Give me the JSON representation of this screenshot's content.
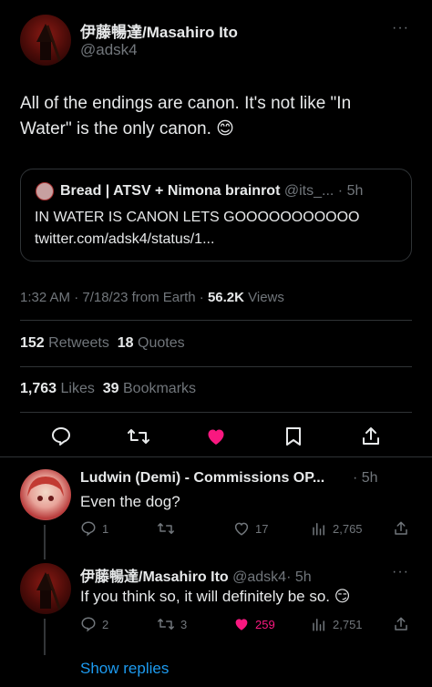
{
  "main_tweet": {
    "author_name": "伊藤暢達/Masahiro Ito",
    "handle": "@adsk4",
    "text": "All of the endings are canon. It's not like \"In Water\" is the only canon.",
    "emoji": "😊",
    "quote": {
      "author_name": "Bread | ATSV + Nimona brainrot",
      "handle": "@its_...",
      "time": "· 5h",
      "text": "IN WATER IS CANON LETS GOOOOOOOOOOO",
      "link": "twitter.com/adsk4/status/1..."
    },
    "meta_time": "1:32 AM · 7/18/23 from Earth · ",
    "views_count": "56.2K",
    "views_label": " Views",
    "stats": {
      "retweets_count": "152",
      "retweets_label": "Retweets",
      "quotes_count": "18",
      "quotes_label": "Quotes",
      "likes_count": "1,763",
      "likes_label": "Likes",
      "bookmarks_count": "39",
      "bookmarks_label": "Bookmarks"
    }
  },
  "replies": [
    {
      "author_name": "Ludwin (Demi) - Commissions OP...",
      "time": "· 5h",
      "text": "Even the dog?",
      "reply_count": "1",
      "retweet_count": "",
      "like_count": "17",
      "view_count": "2,765"
    },
    {
      "author_name": "伊藤暢達/Masahiro Ito",
      "handle": "@adsk4",
      "time": "· 5h",
      "text": "If you think so, it will definitely be so.",
      "emoji": "😏",
      "reply_count": "2",
      "retweet_count": "3",
      "like_count": "259",
      "view_count": "2,751"
    }
  ],
  "show_replies": "Show replies",
  "more_glyph": "···",
  "colors": {
    "background": "#000000",
    "accent": "#1d9bf0",
    "like": "#f91880",
    "muted": "#71767b"
  }
}
